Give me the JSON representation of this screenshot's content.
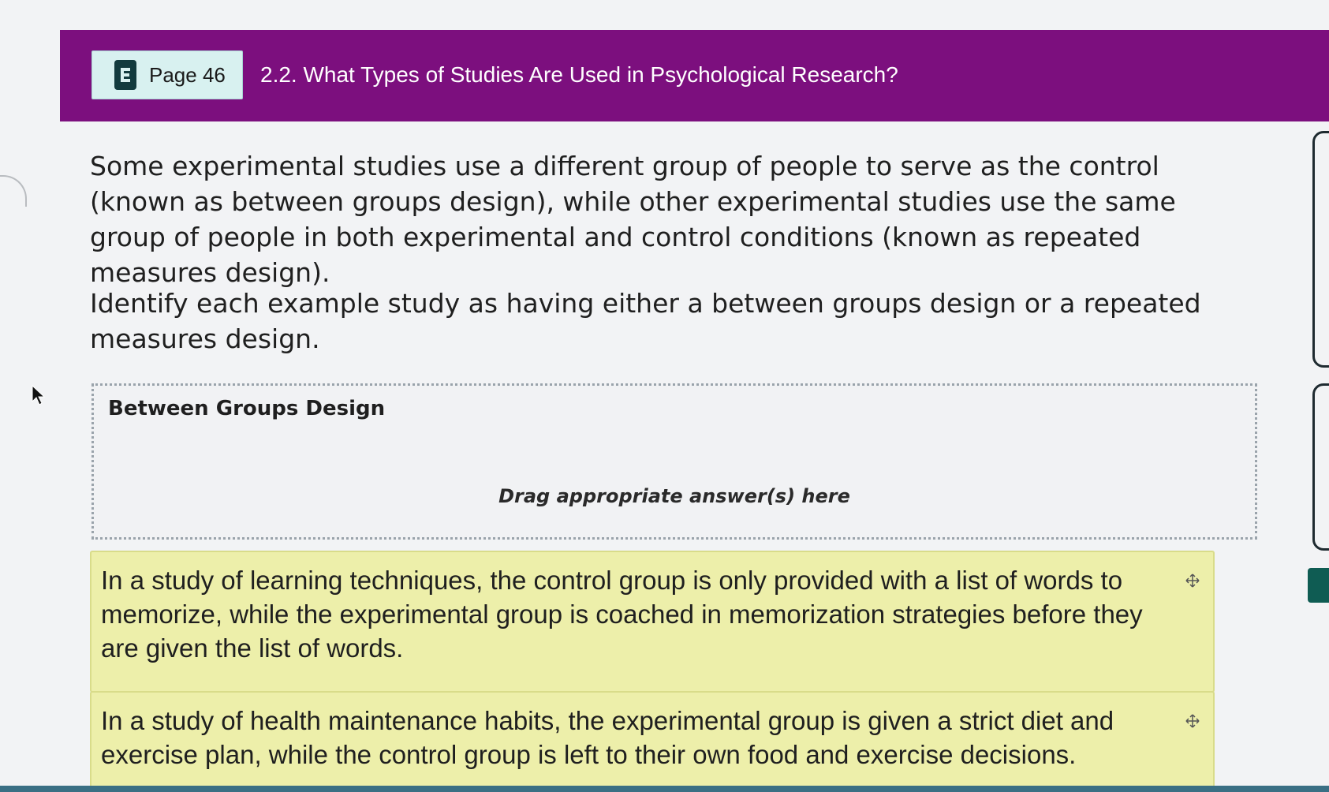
{
  "header": {
    "badge_label": "Page 46",
    "title": "2.2. What Types of Studies Are Used in Psychological Research?",
    "ebook_icon": "ebook-e-icon"
  },
  "content": {
    "intro": "Some experimental studies use a different group of people to serve as the control (known as between groups design), while other experimental studies use the same group of people in both experimental and control conditions (known as repeated measures design).",
    "instructions": "Identify each example study as having either a between groups design or a repeated measures design."
  },
  "drop_zone": {
    "title": "Between Groups Design",
    "hint": "Drag appropriate answer(s) here"
  },
  "answers": [
    {
      "text": "In a study of learning techniques, the control group is only provided with a list of words to memorize, while the experimental group is coached in memorization strategies before they are given the list of words.",
      "icon": "move-icon"
    },
    {
      "text": "In a study of health maintenance habits, the experimental group is given a strict diet and exercise plan, while the control group is left to their own food and exercise decisions.",
      "icon": "move-icon"
    }
  ],
  "colors": {
    "header_bg": "#7c0f7e",
    "badge_bg": "#d8f1f0",
    "answer_bg": "#edefaa",
    "side_tab": "#0f5c53"
  }
}
